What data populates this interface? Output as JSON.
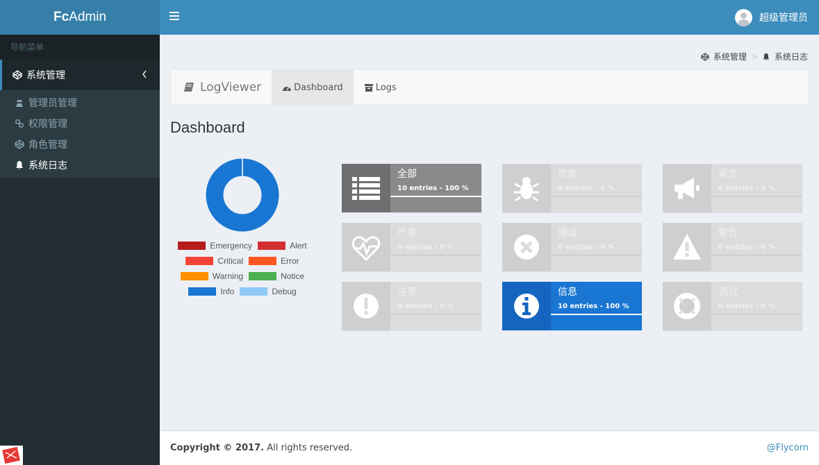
{
  "header": {
    "logo_bold": "Fc",
    "logo_rest": "Admin",
    "user_name": "超级管理员"
  },
  "sidebar": {
    "header": "导航菜单",
    "main_item": "系统管理",
    "items": [
      {
        "label": "管理员管理",
        "icon": "user-secret-icon"
      },
      {
        "label": "权限管理",
        "icon": "link-icon"
      },
      {
        "label": "角色管理",
        "icon": "codepen-icon"
      },
      {
        "label": "系统日志",
        "icon": "bell-icon"
      }
    ]
  },
  "breadcrumb": {
    "item1": "系统管理",
    "separator": ">",
    "item2": "系统日志"
  },
  "nav": {
    "brand": "LogViewer",
    "tab_dashboard": "Dashboard",
    "tab_logs": "Logs"
  },
  "page_title": "Dashboard",
  "chart_data": {
    "type": "pie",
    "categories": [
      "Emergency",
      "Alert",
      "Critical",
      "Error",
      "Warning",
      "Notice",
      "Info",
      "Debug"
    ],
    "values": [
      0,
      0,
      0,
      0,
      0,
      0,
      10,
      0
    ],
    "colors": [
      "#b71c1c",
      "#d32f2f",
      "#f44336",
      "#ff5722",
      "#ff9100",
      "#4caf50",
      "#1976d2",
      "#90caf9"
    ]
  },
  "boxes": [
    {
      "name": "全部",
      "entries": "10 entries - 100 %",
      "percent": 100,
      "icon": "list-icon",
      "style": "all"
    },
    {
      "name": "危急",
      "entries": "0 entries - 0 %",
      "percent": 0,
      "icon": "bug-icon",
      "style": "off"
    },
    {
      "name": "紧急",
      "entries": "0 entries - 0 %",
      "percent": 0,
      "icon": "bullhorn-icon",
      "style": "off"
    },
    {
      "name": "严重",
      "entries": "0 entries - 0 %",
      "percent": 0,
      "icon": "heartbeat-icon",
      "style": "off"
    },
    {
      "name": "错误",
      "entries": "0 entries - 0 %",
      "percent": 0,
      "icon": "times-circle-icon",
      "style": "off"
    },
    {
      "name": "警告",
      "entries": "0 entries - 0 %",
      "percent": 0,
      "icon": "warning-icon",
      "style": "off"
    },
    {
      "name": "注意",
      "entries": "0 entries - 0 %",
      "percent": 0,
      "icon": "exclamation-circle-icon",
      "style": "off"
    },
    {
      "name": "信息",
      "entries": "10 entries - 100 %",
      "percent": 100,
      "icon": "info-circle-icon",
      "style": "info"
    },
    {
      "name": "调试",
      "entries": "0 entries - 0 %",
      "percent": 0,
      "icon": "life-ring-icon",
      "style": "off"
    }
  ],
  "footer": {
    "copyright_bold": "Copyright © 2017.",
    "copyright_rest": " All rights reserved.",
    "link": "@Flycorn"
  }
}
